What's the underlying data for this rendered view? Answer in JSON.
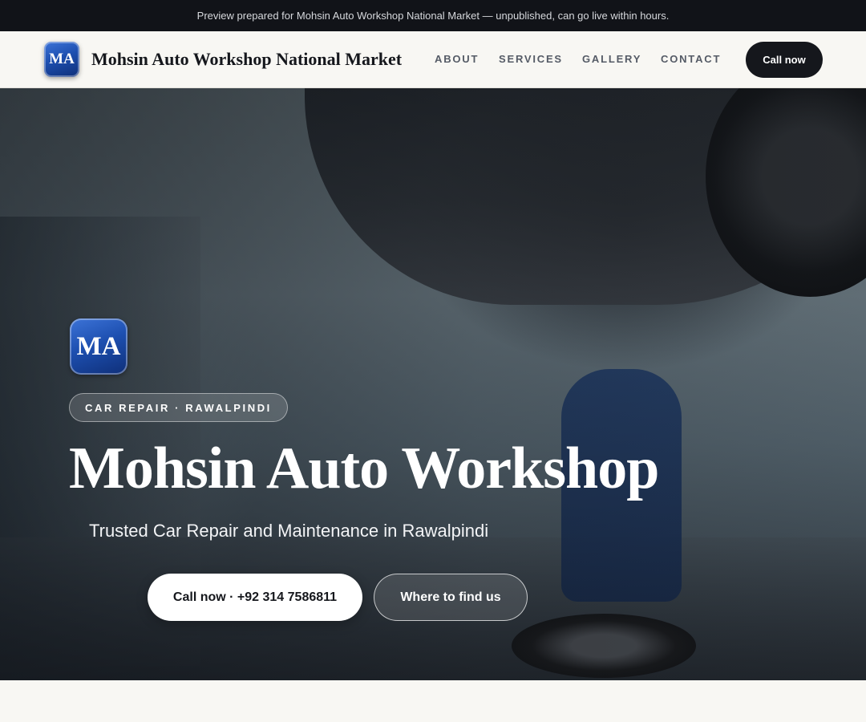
{
  "preview_banner": {
    "text": "Preview prepared for Mohsin Auto Workshop National Market — unpublished, can go live within hours."
  },
  "header": {
    "logo_text": "MA",
    "brand_name": "Mohsin Auto Workshop National Market",
    "nav": [
      {
        "label": "ABOUT"
      },
      {
        "label": "SERVICES"
      },
      {
        "label": "GALLERY"
      },
      {
        "label": "CONTACT"
      }
    ],
    "cta_label": "Call now"
  },
  "hero": {
    "logo_text": "MA",
    "tag": "CAR REPAIR · RAWALPINDI",
    "title": "Mohsin Auto Workshop",
    "subtitle": "Trusted Car Repair and Maintenance in Rawalpindi",
    "primary_button": "Call now · +92 314 7586811",
    "secondary_button": "Where to find us"
  },
  "colors": {
    "banner_bg": "#111318",
    "nav_bg": "#f8f7f3",
    "dark_button": "#15171c",
    "logo_blue": "#1d4fb0"
  }
}
